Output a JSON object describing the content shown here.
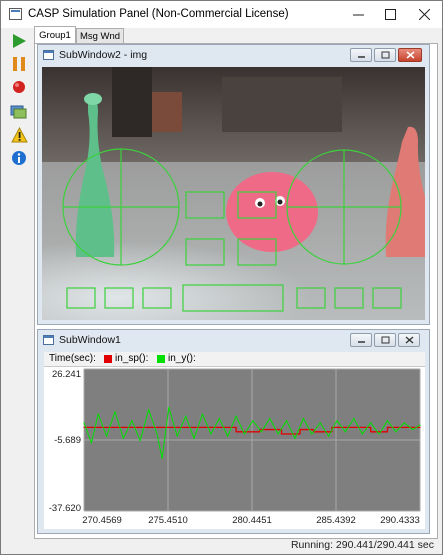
{
  "window": {
    "title": "CASP Simulation Panel (Non-Commercial License)"
  },
  "toolbar": {
    "items": [
      "play-icon",
      "pause-icon",
      "record-icon",
      "layers-icon",
      "warning-icon",
      "info-icon"
    ]
  },
  "tabs": [
    {
      "label": "Group1",
      "active": true
    },
    {
      "label": "Msg Wnd",
      "active": false
    }
  ],
  "subwindow2": {
    "title": "SubWindow2 - img"
  },
  "subwindow1": {
    "title": "SubWindow1",
    "legend": {
      "time_label": "Time(sec):",
      "series": [
        "in_sp():",
        "in_y():"
      ]
    }
  },
  "status": {
    "text": "Running: 290.441/290.441 sec"
  },
  "colors": {
    "series_in_sp": "#e00000",
    "series_in_y": "#00e000",
    "overlay": "#3cd13c",
    "plot_bg": "#7f7f7f"
  },
  "chart_data": {
    "type": "line",
    "title": "",
    "xlabel": "",
    "ylabel": "",
    "ylim": [
      -37.62,
      26.241
    ],
    "xlim": [
      270.4569,
      290.4333
    ],
    "y_ticks": [
      "26.241",
      "-5.689",
      "-37.620"
    ],
    "x_ticks": [
      "270.4569",
      "275.4510",
      "280.4451",
      "285.4392",
      "290.4333"
    ],
    "grid": true,
    "series": [
      {
        "name": "in_sp()",
        "color": "#e00000",
        "x": [
          270.46,
          274.5,
          279.5,
          280.9,
          282.2,
          283.3,
          284.1,
          285.2,
          287.5,
          288.5,
          290.43
        ],
        "values": [
          0,
          0,
          -2,
          -1,
          -3,
          -1,
          -2,
          0,
          -2,
          0,
          0
        ]
      },
      {
        "name": "in_y()",
        "color": "#00e000",
        "x": [
          270.46,
          270.9,
          271.3,
          271.8,
          272.3,
          272.8,
          273.3,
          273.8,
          274.3,
          274.8,
          275.1,
          275.5,
          276.0,
          276.5,
          277.0,
          277.5,
          278.0,
          278.5,
          279.0,
          279.5,
          280.0,
          280.5,
          281.0,
          281.5,
          282.0,
          282.5,
          283.0,
          283.5,
          284.0,
          284.5,
          285.0,
          285.5,
          286.0,
          286.5,
          287.0,
          287.5,
          288.0,
          288.5,
          289.0,
          289.5,
          290.0,
          290.43
        ],
        "values": [
          2,
          -7,
          6,
          -4,
          7,
          -5,
          3,
          -6,
          8,
          -3,
          -14,
          9,
          -4,
          5,
          -5,
          6,
          -3,
          4,
          -4,
          5,
          -3,
          3,
          -2,
          4,
          -3,
          3,
          -5,
          4,
          -3,
          2,
          -4,
          3,
          -2,
          4,
          -3,
          2,
          -3,
          3,
          -2,
          2,
          -1,
          1
        ]
      }
    ]
  }
}
